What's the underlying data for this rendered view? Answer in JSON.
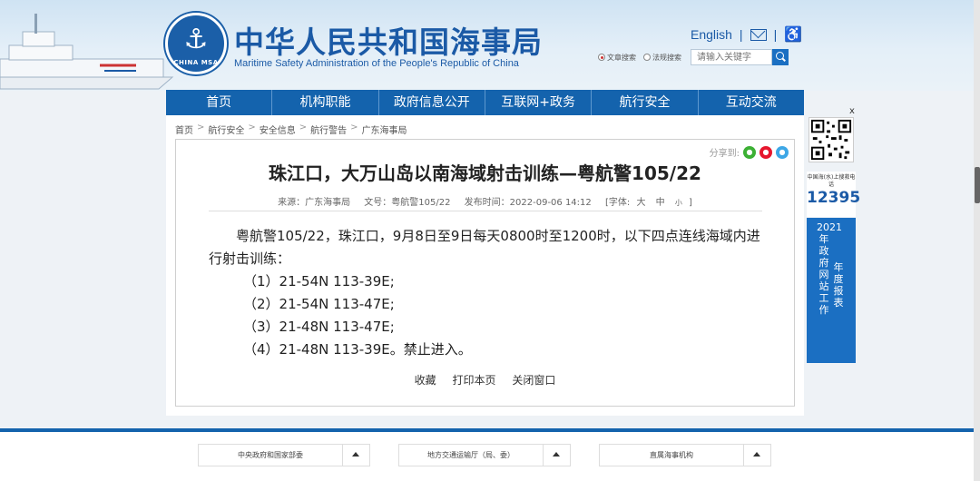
{
  "header": {
    "logo_top": "中国海事局",
    "logo_bottom": "CHINA MSA",
    "title": "中华人民共和国海事局",
    "subtitle": "Maritime Safety Administration of the People's Republic of China",
    "english_link": "English",
    "search": {
      "option_1": "文章搜索",
      "option_2": "法规搜索",
      "placeholder": "请输入关键字"
    }
  },
  "nav": {
    "items": [
      "首页",
      "机构职能",
      "政府信息公开",
      "互联网+政务",
      "航行安全",
      "互动交流"
    ]
  },
  "breadcrumb": [
    "首页",
    "航行安全",
    "安全信息",
    "航行警告",
    "广东海事局"
  ],
  "article": {
    "share_label": "分享到:",
    "title": "珠江口，大万山岛以南海域射击训练—粤航警105/22",
    "meta": {
      "source": "来源：广东海事局",
      "doc_no": "文号：粤航警105/22",
      "date": "发布时间：2022-09-06 14:12",
      "font": "[字体:",
      "font_large": "大",
      "font_mid": "中",
      "font_small": "小",
      "font_end": "]"
    },
    "lead": "粤航警105/22，珠江口，9月8日至9日每天0800时至1200时，以下四点连线海域内进行射击训练：",
    "coords": [
      "（1）21-54N 113-39E;",
      "（2）21-54N 113-47E;",
      "（3）21-48N 113-47E;",
      "（4）21-48N 113-39E。禁止进入。"
    ],
    "actions": {
      "collect": "收藏",
      "print": "打印本页",
      "close": "关闭窗口"
    }
  },
  "side": {
    "close": "x",
    "hotline_label": "中国海(水)上搜救电话",
    "hotline_number": "12395",
    "report_col1": "2021年政府网站工作",
    "report_col2": "年度报表"
  },
  "footer": {
    "select_1": "中央政府和国家部委",
    "select_2": "地方交通运输厅（局、委）",
    "select_3": "直属海事机构"
  },
  "colors": {
    "brand_blue": "#1463ad",
    "title_blue": "#1b5aa6"
  }
}
